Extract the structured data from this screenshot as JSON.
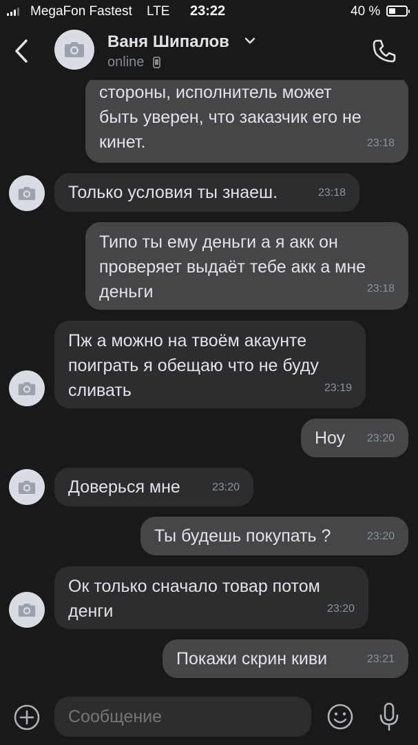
{
  "status_bar": {
    "carrier": "MegaFon Fastest",
    "network": "LTE",
    "time": "23:22",
    "battery": "40 %"
  },
  "header": {
    "name": "Ваня Шипалов",
    "status": "online"
  },
  "messages": [
    {
      "direction": "out",
      "text": "стороны, исполнитель может\nбыть уверен, что заказчик его не\nкинет.",
      "time": "23:18"
    },
    {
      "direction": "in",
      "text": "Только условия ты знаеш.",
      "time": "23:18"
    },
    {
      "direction": "out",
      "text": "Типо ты ему деньги а я акк он\nпроверяет выдаёт тебе акк а мне\nденьги",
      "time": "23:18"
    },
    {
      "direction": "in",
      "text": "Пж а можно на твоём акаунте\nпоиграть я обещаю что не буду\nсливать",
      "time": "23:19"
    },
    {
      "direction": "out",
      "text": "Ноу",
      "time": "23:20"
    },
    {
      "direction": "in",
      "text": "Доверься мне",
      "time": "23:20"
    },
    {
      "direction": "out",
      "text": "Ты будешь покупать ?",
      "time": "23:20"
    },
    {
      "direction": "in",
      "text": "Ок только сначало товар потом\nденги",
      "time": "23:20"
    },
    {
      "direction": "out",
      "text": "Покажи скрин киви",
      "time": "23:21"
    }
  ],
  "compose": {
    "placeholder": "Сообщение"
  },
  "icons": {
    "back": "chevron-left-icon",
    "avatar": "camera-icon",
    "call": "phone-icon",
    "attach": "plus-circle-icon",
    "emoji": "smile-icon",
    "mic": "microphone-icon"
  },
  "colors": {
    "background": "#19191a",
    "outgoing_bubble": "#454647",
    "incoming_bubble": "#2c2d2e",
    "text": "#e1e3e6",
    "secondary_text": "#8e9297"
  }
}
